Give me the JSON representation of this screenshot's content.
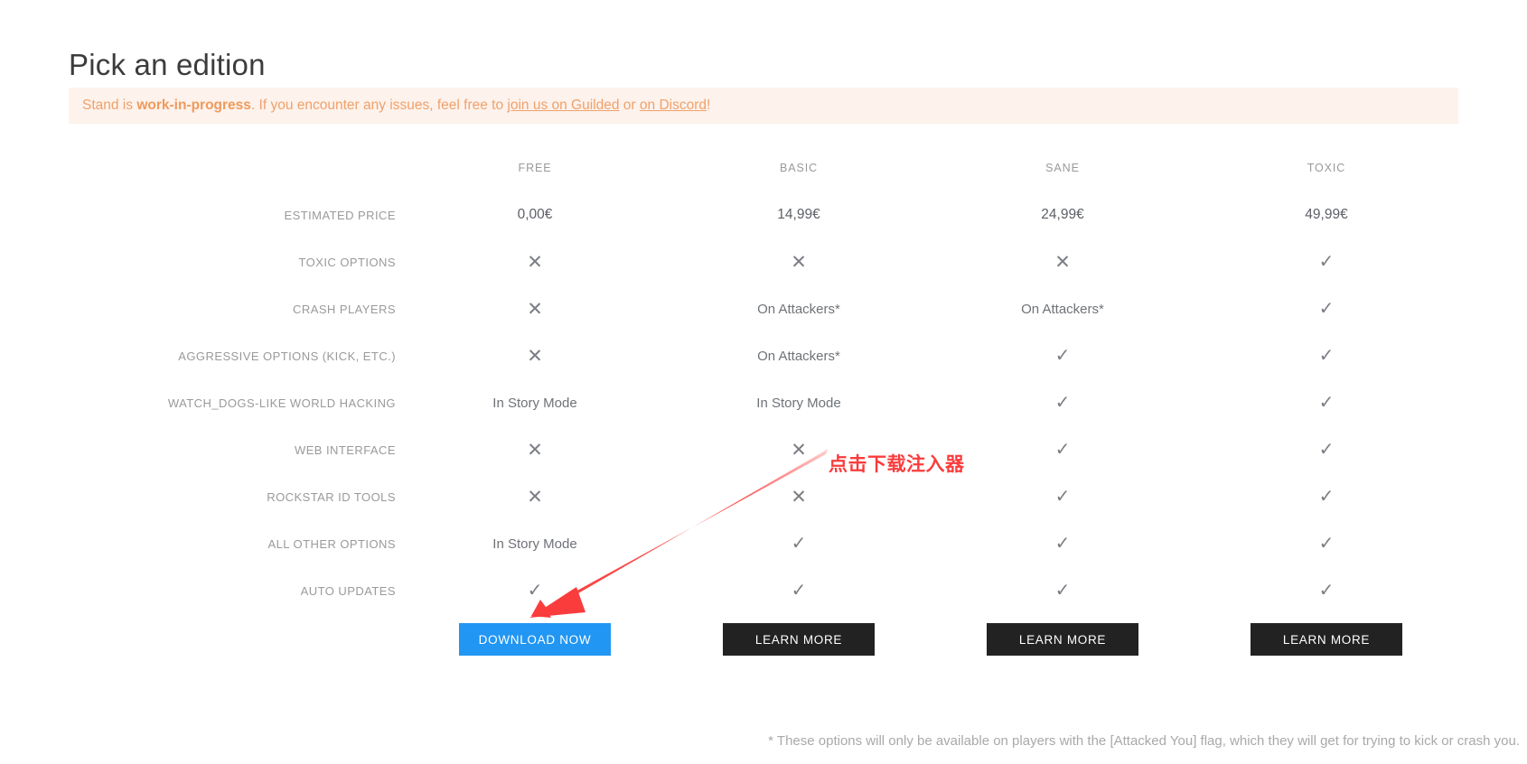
{
  "page": {
    "title": "Pick an edition"
  },
  "banner": {
    "prefix": "Stand is ",
    "strong": "work-in-progress",
    "middle": ". If you encounter any issues, feel free to ",
    "link1": "join us on Guilded",
    "conjunction": " or ",
    "link2": "on Discord",
    "suffix": "!",
    "background_color": "#fdf2ec",
    "text_color": "#f0a16a"
  },
  "table": {
    "columns": [
      "FREE",
      "BASIC",
      "SANE",
      "TOXIC"
    ],
    "rows": [
      {
        "label": "ESTIMATED PRICE",
        "values": [
          "0,00€",
          "14,99€",
          "24,99€",
          "49,99€"
        ],
        "types": [
          "price",
          "price",
          "price",
          "price"
        ]
      },
      {
        "label": "TOXIC OPTIONS",
        "values": [
          "✕",
          "✕",
          "✕",
          "✓"
        ],
        "types": [
          "cross",
          "cross",
          "cross",
          "check"
        ]
      },
      {
        "label": "CRASH PLAYERS",
        "values": [
          "✕",
          "On Attackers*",
          "On Attackers*",
          "✓"
        ],
        "types": [
          "cross",
          "text",
          "text",
          "check"
        ]
      },
      {
        "label": "AGGRESSIVE OPTIONS (KICK, ETC.)",
        "values": [
          "✕",
          "On Attackers*",
          "✓",
          "✓"
        ],
        "types": [
          "cross",
          "text",
          "check",
          "check"
        ]
      },
      {
        "label": "WATCH_DOGS-LIKE WORLD HACKING",
        "values": [
          "In Story Mode",
          "In Story Mode",
          "✓",
          "✓"
        ],
        "types": [
          "text",
          "text",
          "check",
          "check"
        ]
      },
      {
        "label": "WEB INTERFACE",
        "values": [
          "✕",
          "✕",
          "✓",
          "✓"
        ],
        "types": [
          "cross",
          "cross",
          "check",
          "check"
        ]
      },
      {
        "label": "ROCKSTAR ID TOOLS",
        "values": [
          "✕",
          "✕",
          "✓",
          "✓"
        ],
        "types": [
          "cross",
          "cross",
          "check",
          "check"
        ]
      },
      {
        "label": "ALL OTHER OPTIONS",
        "values": [
          "In Story Mode",
          "✓",
          "✓",
          "✓"
        ],
        "types": [
          "text",
          "check",
          "check",
          "check"
        ]
      },
      {
        "label": "AUTO UPDATES",
        "values": [
          "✓",
          "✓",
          "✓",
          "✓"
        ],
        "types": [
          "check",
          "check",
          "check",
          "check"
        ]
      }
    ]
  },
  "buttons": [
    {
      "label": "DOWNLOAD NOW",
      "style": "primary",
      "color": "#2196f3"
    },
    {
      "label": "LEARN MORE",
      "style": "dark",
      "color": "#222222"
    },
    {
      "label": "LEARN MORE",
      "style": "dark",
      "color": "#222222"
    },
    {
      "label": "LEARN MORE",
      "style": "dark",
      "color": "#222222"
    }
  ],
  "footnote": {
    "text": "* These options will only be available on players with the [Attacked You] flag, which they will get for trying to kick or crash you."
  },
  "annotation": {
    "text": "点击下载注入器",
    "color": "#fa3c3c"
  }
}
